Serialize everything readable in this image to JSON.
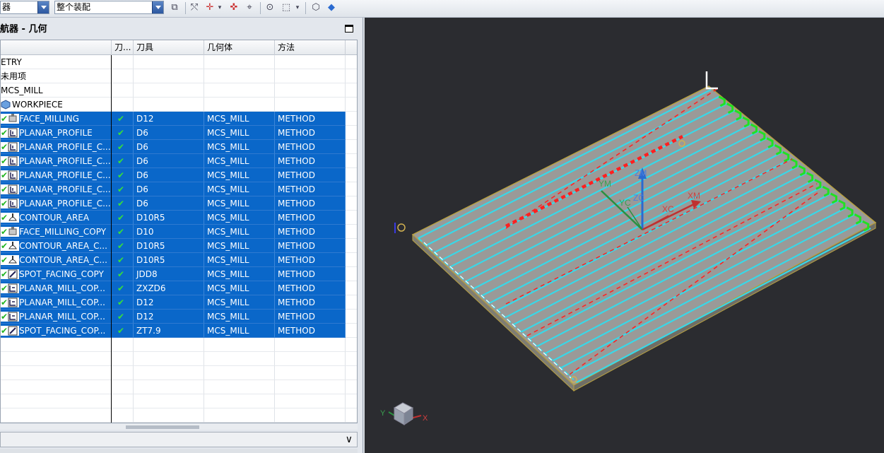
{
  "toolbar": {
    "filter_value": "器",
    "scope_value": "整个装配"
  },
  "navigator": {
    "title": "航器 - 几何",
    "columns": [
      "刀...",
      "刀具",
      "几何体",
      "方法"
    ],
    "tree": [
      {
        "name": "ETRY"
      },
      {
        "name": "未用项"
      },
      {
        "name": "MCS_MILL"
      },
      {
        "name": "WORKPIECE"
      }
    ],
    "operations": [
      {
        "name": "FACE_MILLING",
        "icon": "face-milling-icon",
        "tool": "D12",
        "geometry": "MCS_MILL",
        "method": "METHOD"
      },
      {
        "name": "PLANAR_PROFILE",
        "icon": "planar-profile-icon",
        "tool": "D6",
        "geometry": "MCS_MILL",
        "method": "METHOD"
      },
      {
        "name": "PLANAR_PROFILE_C...",
        "icon": "planar-profile-icon",
        "tool": "D6",
        "geometry": "MCS_MILL",
        "method": "METHOD"
      },
      {
        "name": "PLANAR_PROFILE_C...",
        "icon": "planar-profile-icon",
        "tool": "D6",
        "geometry": "MCS_MILL",
        "method": "METHOD"
      },
      {
        "name": "PLANAR_PROFILE_C...",
        "icon": "planar-profile-icon",
        "tool": "D6",
        "geometry": "MCS_MILL",
        "method": "METHOD"
      },
      {
        "name": "PLANAR_PROFILE_C...",
        "icon": "planar-profile-icon",
        "tool": "D6",
        "geometry": "MCS_MILL",
        "method": "METHOD"
      },
      {
        "name": "PLANAR_PROFILE_C...",
        "icon": "planar-profile-icon",
        "tool": "D6",
        "geometry": "MCS_MILL",
        "method": "METHOD"
      },
      {
        "name": "CONTOUR_AREA",
        "icon": "contour-area-icon",
        "tool": "D10R5",
        "geometry": "MCS_MILL",
        "method": "METHOD"
      },
      {
        "name": "FACE_MILLING_COPY",
        "icon": "face-milling-icon",
        "tool": "D10",
        "geometry": "MCS_MILL",
        "method": "METHOD"
      },
      {
        "name": "CONTOUR_AREA_C...",
        "icon": "contour-area-icon",
        "tool": "D10R5",
        "geometry": "MCS_MILL",
        "method": "METHOD"
      },
      {
        "name": "CONTOUR_AREA_C...",
        "icon": "contour-area-icon",
        "tool": "D10R5",
        "geometry": "MCS_MILL",
        "method": "METHOD"
      },
      {
        "name": "SPOT_FACING_COPY",
        "icon": "spot-facing-icon",
        "tool": "JDD8",
        "geometry": "MCS_MILL",
        "method": "METHOD"
      },
      {
        "name": "PLANAR_MILL_COP...",
        "icon": "planar-mill-icon",
        "tool": "ZXZD6",
        "geometry": "MCS_MILL",
        "method": "METHOD"
      },
      {
        "name": "PLANAR_MILL_COP...",
        "icon": "planar-mill-icon",
        "tool": "D12",
        "geometry": "MCS_MILL",
        "method": "METHOD"
      },
      {
        "name": "PLANAR_MILL_COP...",
        "icon": "planar-mill-icon",
        "tool": "D12",
        "geometry": "MCS_MILL",
        "method": "METHOD"
      },
      {
        "name": "SPOT_FACING_COP...",
        "icon": "spot-facing-icon",
        "tool": "ZT7.9",
        "geometry": "MCS_MILL",
        "method": "METHOD"
      }
    ],
    "check_glyph": "✔"
  },
  "viewport": {
    "csys_labels": [
      "ZM",
      "YM",
      "XM",
      "ZC",
      "YC",
      "XC"
    ],
    "triad_labels": [
      "Y",
      "X"
    ],
    "colors": {
      "background": "#2b2c30",
      "toolpath": "#38d8e8",
      "rapid": "#ff2020",
      "engage": "#22e022",
      "part_edge": "#b8a040",
      "selection": "#0a67c9"
    }
  }
}
